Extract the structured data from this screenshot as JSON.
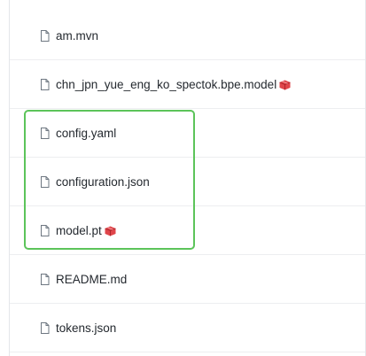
{
  "files": [
    {
      "name": "am.mvn",
      "lfs": false,
      "icon": "file-icon"
    },
    {
      "name": "chn_jpn_yue_eng_ko_spectok.bpe.model",
      "lfs": true,
      "icon": "file-icon"
    },
    {
      "name": "config.yaml",
      "lfs": false,
      "icon": "file-icon"
    },
    {
      "name": "configuration.json",
      "lfs": false,
      "icon": "file-icon"
    },
    {
      "name": "model.pt",
      "lfs": true,
      "icon": "file-icon"
    },
    {
      "name": "README.md",
      "lfs": false,
      "icon": "file-icon"
    },
    {
      "name": "tokens.json",
      "lfs": false,
      "icon": "file-icon"
    }
  ],
  "highlight": {
    "color": "#5cc45a"
  },
  "lfs_badge": {
    "icon": "lfs-package-icon",
    "color": "#e0454a"
  }
}
